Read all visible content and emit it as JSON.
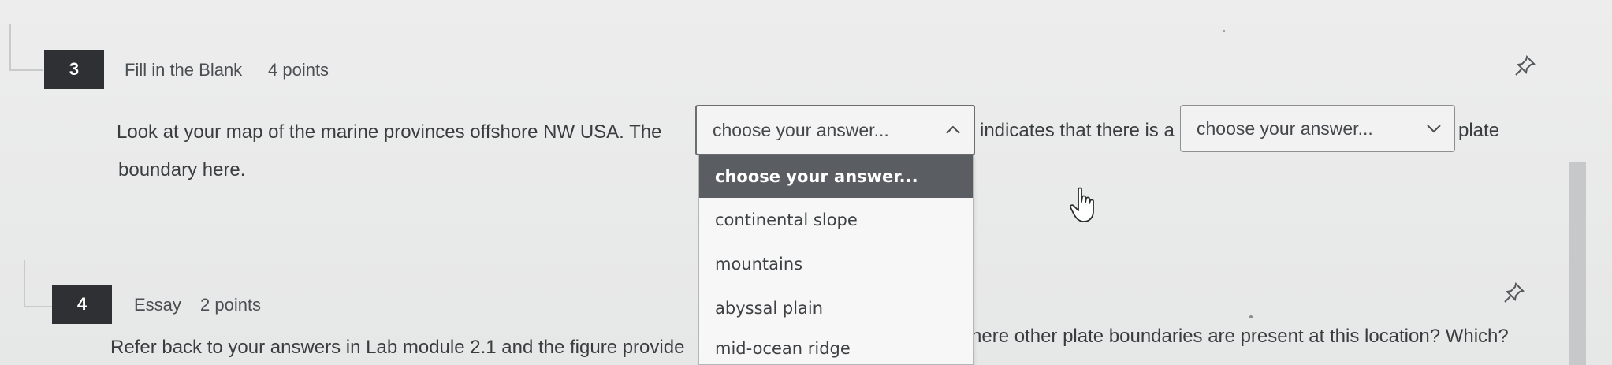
{
  "questions": [
    {
      "number": "3",
      "type": "Fill in the Blank",
      "points": "4 points",
      "prompt": {
        "before": "Look at your map of the marine provinces offshore NW USA. The",
        "middle": "indicates that there is a",
        "after": "plate",
        "line2": "boundary here."
      },
      "select1": {
        "value": "choose your answer...",
        "open": true,
        "options": [
          "choose your answer...",
          "continental slope",
          "mountains",
          "abyssal plain",
          "mid-ocean ridge"
        ]
      },
      "select2": {
        "value": "choose your answer..."
      }
    },
    {
      "number": "4",
      "type": "Essay",
      "points": "2 points",
      "prompt": {
        "left": "Refer back to your answers in Lab module 2.1 and the figure provide",
        "right": "here other plate boundaries are present at this location? Which?"
      }
    }
  ],
  "icons": {
    "pin": "pin-icon",
    "chevron_up": "chevron-up-icon",
    "chevron_down": "chevron-down-icon",
    "cursor": "hand-pointer-icon"
  },
  "colors": {
    "number_badge": "#2f3033",
    "selected_option": "#5a5e63",
    "background": "#e9eaea"
  }
}
